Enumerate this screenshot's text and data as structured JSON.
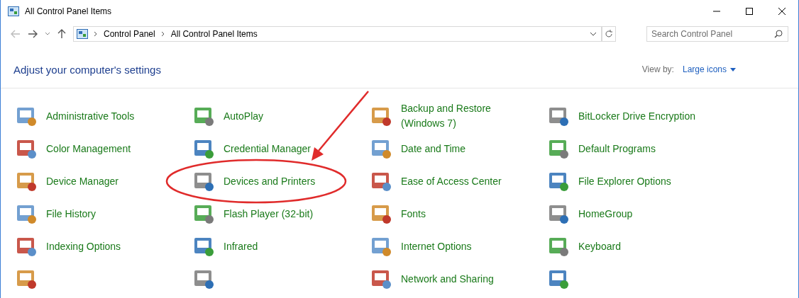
{
  "window": {
    "title": "All Control Panel Items"
  },
  "address_bar": {
    "path": [
      "Control Panel",
      "All Control Panel Items"
    ]
  },
  "search": {
    "placeholder": "Search Control Panel"
  },
  "heading": "Adjust your computer's settings",
  "view_by": {
    "label": "View by:",
    "value": "Large icons"
  },
  "items": [
    {
      "kind": "applet",
      "label": "Administrative Tools"
    },
    {
      "kind": "applet",
      "label": "AutoPlay"
    },
    {
      "kind": "applet",
      "label": "Backup and Restore (Windows 7)"
    },
    {
      "kind": "applet",
      "label": "BitLocker Drive Encryption"
    },
    {
      "kind": "applet",
      "label": "Color Management"
    },
    {
      "kind": "applet",
      "label": "Credential Manager"
    },
    {
      "kind": "applet",
      "label": "Date and Time"
    },
    {
      "kind": "applet",
      "label": "Default Programs"
    },
    {
      "kind": "applet",
      "label": "Device Manager"
    },
    {
      "kind": "applet",
      "label": "Devices and Printers"
    },
    {
      "kind": "applet",
      "label": "Ease of Access Center"
    },
    {
      "kind": "applet",
      "label": "File Explorer Options"
    },
    {
      "kind": "applet",
      "label": "File History"
    },
    {
      "kind": "applet",
      "label": "Flash Player (32-bit)"
    },
    {
      "kind": "applet",
      "label": "Fonts"
    },
    {
      "kind": "applet",
      "label": "HomeGroup"
    },
    {
      "kind": "applet",
      "label": "Indexing Options"
    },
    {
      "kind": "applet",
      "label": "Infrared"
    },
    {
      "kind": "applet",
      "label": "Internet Options"
    },
    {
      "kind": "applet",
      "label": "Keyboard"
    },
    {
      "kind": "icon"
    },
    {
      "kind": "icon"
    },
    {
      "kind": "applet",
      "label": "Network and Sharing"
    },
    {
      "kind": "icon"
    }
  ]
}
